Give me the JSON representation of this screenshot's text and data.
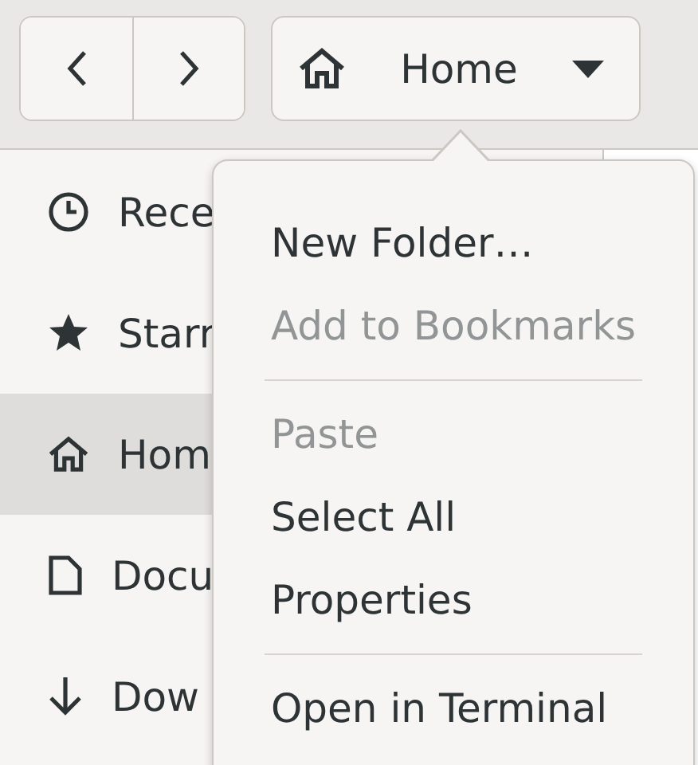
{
  "header": {
    "nav_buttons": [
      {
        "kind": "back"
      },
      {
        "kind": "forward"
      }
    ],
    "location": {
      "label": "Home"
    }
  },
  "sidebar": {
    "items": [
      {
        "kind": "clock",
        "label": "Rece",
        "selected": false
      },
      {
        "kind": "star",
        "label": "Starr",
        "selected": false
      },
      {
        "kind": "home",
        "label": "Hom",
        "selected": true
      },
      {
        "kind": "document",
        "label": "Docu",
        "selected": false
      },
      {
        "kind": "download",
        "label": "Dow",
        "selected": false
      }
    ]
  },
  "menu": {
    "items": [
      {
        "kind": "item",
        "label": "New Folder…",
        "disabled": false
      },
      {
        "kind": "item",
        "label": "Add to Bookmarks",
        "disabled": true
      },
      {
        "kind": "separator"
      },
      {
        "kind": "item",
        "label": "Paste",
        "disabled": true
      },
      {
        "kind": "item",
        "label": "Select All",
        "disabled": false
      },
      {
        "kind": "item",
        "label": "Properties",
        "disabled": false
      },
      {
        "kind": "separator"
      },
      {
        "kind": "item",
        "label": "Open in Terminal",
        "disabled": false
      }
    ]
  }
}
